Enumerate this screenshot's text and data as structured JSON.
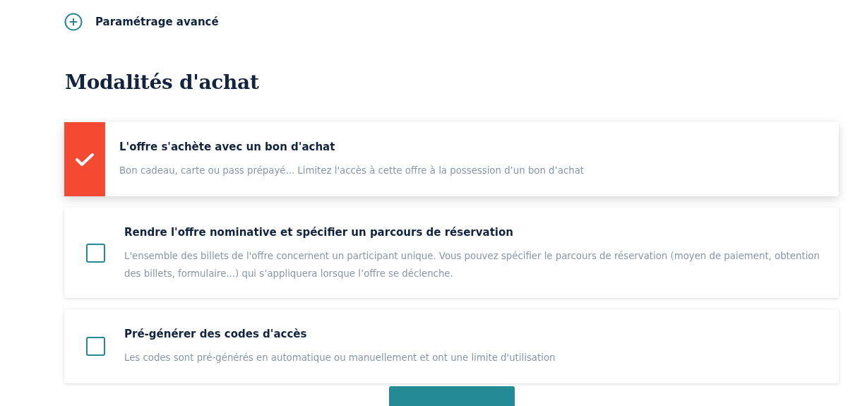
{
  "advanced_settings": {
    "label": "Paramétrage avancé",
    "expanded": false
  },
  "section": {
    "title": "Modalités d'achat"
  },
  "options": [
    {
      "title": "L'offre s'achète avec un bon d'achat",
      "description": "Bon cadeau, carte ou pass prépayé... Limitez l'accès à cette offre à la possession d’un bon d’achat",
      "checked": true
    },
    {
      "title": "Rendre l'offre nominative et spécifier un parcours de réservation",
      "description": "L'ensemble des billets de l'offre concernent un participant unique. Vous pouvez spécifier le parcours de réservation (moyen de paiement, obtention des billets, formulaire...) qui s’appliquera lorsque l’offre se déclenche.",
      "checked": false
    },
    {
      "title": "Pré-générer des codes d'accès",
      "description": "Les codes sont pré-générés en automatique ou manuellement et ont une limite d'utilisation",
      "checked": false
    }
  ]
}
